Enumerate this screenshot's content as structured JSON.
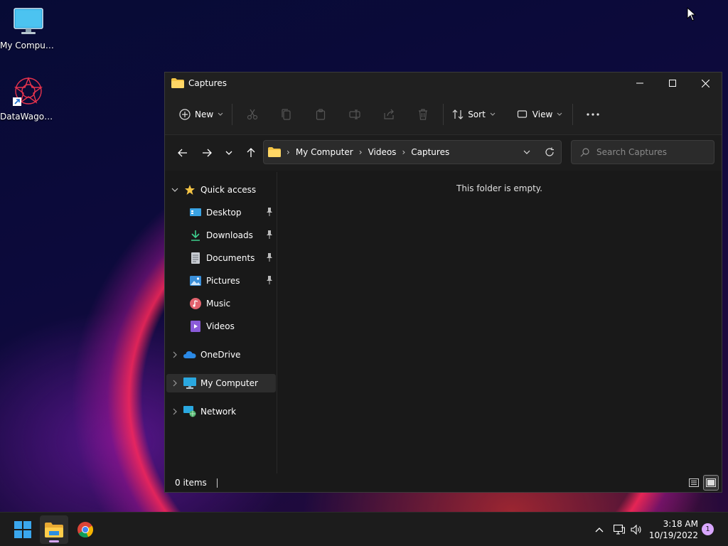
{
  "desktop": {
    "icons": [
      {
        "label": "My Computer"
      },
      {
        "label": "DataWagon..."
      }
    ]
  },
  "window": {
    "title": "Captures",
    "toolbar": {
      "new_label": "New",
      "sort_label": "Sort",
      "view_label": "View"
    },
    "address": {
      "crumbs": [
        "My Computer",
        "Videos",
        "Captures"
      ]
    },
    "search": {
      "placeholder": "Search Captures"
    },
    "sidebar": {
      "quick_access": "Quick access",
      "items": [
        {
          "label": "Desktop",
          "icon": "desktop-icon",
          "pinned": true
        },
        {
          "label": "Downloads",
          "icon": "download-icon",
          "pinned": true
        },
        {
          "label": "Documents",
          "icon": "document-icon",
          "pinned": true
        },
        {
          "label": "Pictures",
          "icon": "picture-icon",
          "pinned": true
        },
        {
          "label": "Music",
          "icon": "music-icon",
          "pinned": false
        },
        {
          "label": "Videos",
          "icon": "video-icon",
          "pinned": false
        }
      ],
      "onedrive": "OneDrive",
      "my_computer": "My Computer",
      "network": "Network"
    },
    "content": {
      "empty_message": "This folder is empty."
    },
    "status": {
      "items_count": "0 items"
    }
  },
  "taskbar": {
    "clock_time": "3:18 AM",
    "clock_date": "10/19/2022",
    "notification_count": "1"
  },
  "colors": {
    "window_bg": "#191919",
    "titlebar_bg": "#202020",
    "folder_yellow": "#f4c445",
    "accent": "#d9a7ff"
  }
}
